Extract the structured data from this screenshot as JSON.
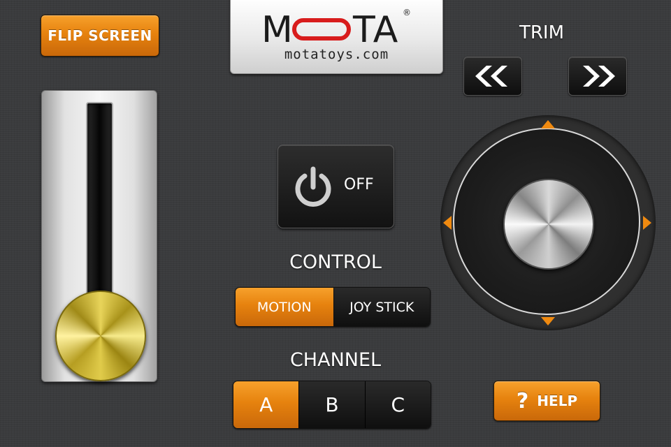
{
  "buttons": {
    "flip_screen": "FLIP SCREEN",
    "power_label": "OFF",
    "help_icon": "?",
    "help_label": "HELP"
  },
  "logo": {
    "brand_left": "M",
    "brand_right": "TA",
    "registered": "®",
    "url": "motatoys.com"
  },
  "trim": {
    "label": "TRIM",
    "left_icon": "double-chevron-left-icon",
    "right_icon": "double-chevron-right-icon"
  },
  "control": {
    "label": "CONTROL",
    "options": [
      "MOTION",
      "JOY STICK"
    ],
    "selected": "MOTION"
  },
  "channel": {
    "label": "CHANNEL",
    "options": [
      "A",
      "B",
      "C"
    ],
    "selected": "A"
  },
  "colors": {
    "accent_orange": "#e6820e",
    "logo_red": "#d81c1c",
    "background": "#3a3b3d"
  }
}
